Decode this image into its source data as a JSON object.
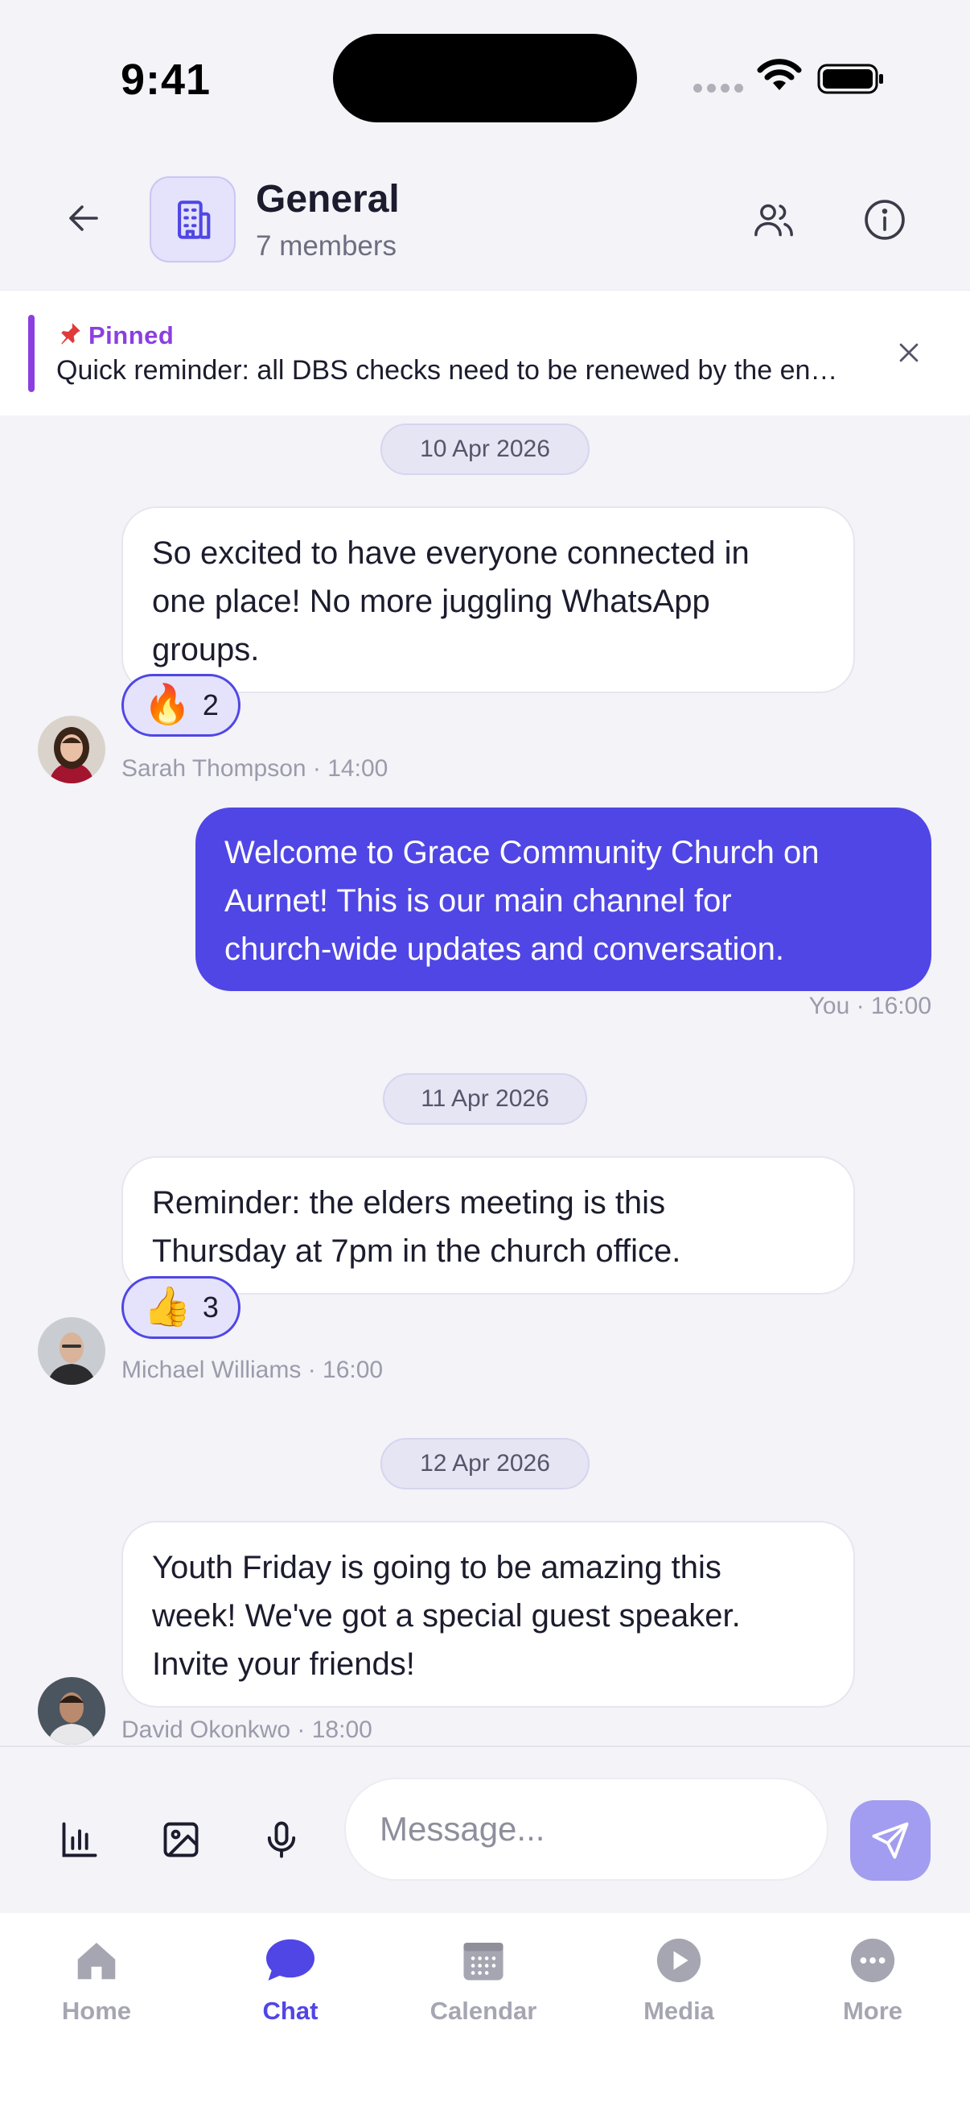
{
  "status_bar": {
    "time": "9:41"
  },
  "header": {
    "back_icon": "arrow-left-icon",
    "channel_icon": "building-icon",
    "title": "General",
    "subtitle": "7 members",
    "members_icon": "users-icon",
    "info_icon": "info-icon"
  },
  "pinned": {
    "label": "Pinned",
    "icon": "pushpin-icon",
    "text": "Quick reminder: all DBS checks need to be renewed by the end of the month. Please contact the office.",
    "close_icon": "close-icon"
  },
  "messages": [
    {
      "date": "10 Apr 2026",
      "text_lines": [
        "So excited to have everyone connected in",
        "one place! No more juggling WhatsApp",
        "groups."
      ],
      "reaction": {
        "emoji": "🔥",
        "count": "2"
      },
      "meta": "Sarah Thompson · 14:00",
      "sender": "Sarah Thompson"
    },
    {
      "own": true,
      "text_lines": [
        "Welcome to Grace Community Church on",
        "Aurnet! This is our main channel for",
        "church-wide updates and conversation."
      ],
      "meta": "You · 16:00"
    },
    {
      "date": "11 Apr 2026",
      "text_lines": [
        "Reminder: the elders meeting is this",
        "Thursday at 7pm in the church office."
      ],
      "reaction": {
        "emoji": "👍",
        "count": "3"
      },
      "meta": "Michael Williams · 16:00",
      "sender": "Michael Williams"
    },
    {
      "date": "12 Apr 2026",
      "text_lines": [
        "Youth Friday is going to be amazing this",
        "week! We've got a special guest speaker.",
        "Invite your friends!"
      ],
      "meta": "David Okonkwo · 18:00",
      "sender": "David Okonkwo"
    }
  ],
  "composer": {
    "placeholder": "Message...",
    "poll_icon": "poll-icon",
    "image_icon": "image-icon",
    "mic_icon": "microphone-icon",
    "send_icon": "send-icon"
  },
  "tabs": [
    {
      "label": "Home",
      "icon": "home-icon",
      "active": false
    },
    {
      "label": "Chat",
      "icon": "chat-icon",
      "active": true
    },
    {
      "label": "Calendar",
      "icon": "calendar-icon",
      "active": false
    },
    {
      "label": "Media",
      "icon": "play-icon",
      "active": false
    },
    {
      "label": "More",
      "icon": "more-icon",
      "active": false
    }
  ],
  "colors": {
    "accent": "#5046e5",
    "pinned": "#8b3fe0",
    "background": "#f3f3f8"
  }
}
